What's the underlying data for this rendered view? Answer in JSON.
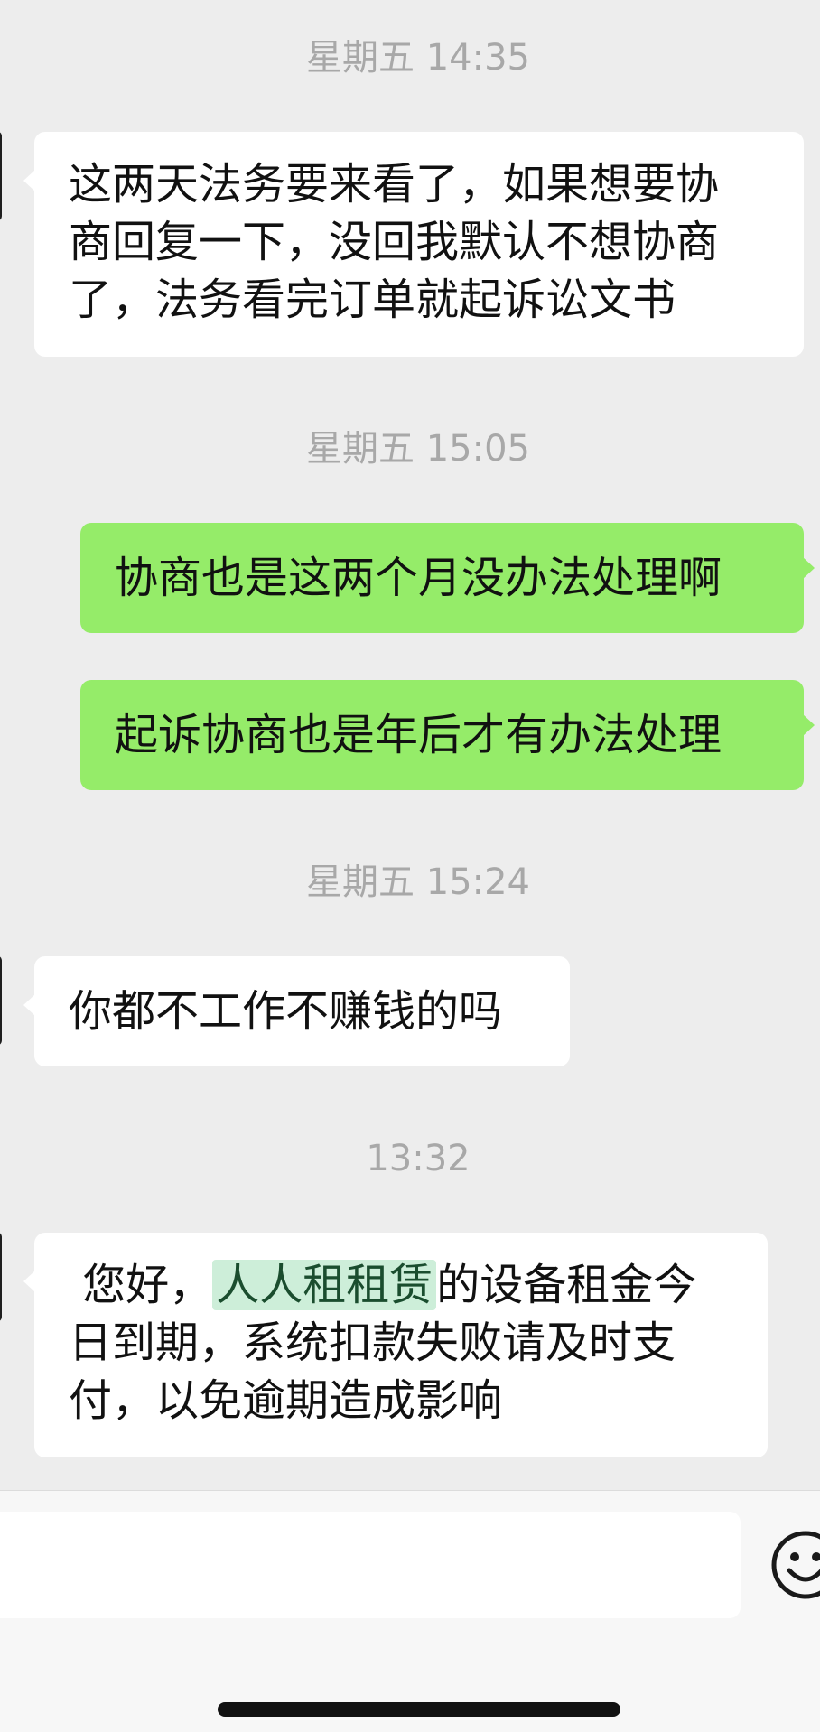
{
  "messages": [
    {
      "type": "time",
      "text": "星期五 14:35"
    },
    {
      "type": "in",
      "lines": [
        "这两天法务要来看了，如果想要协",
        "商回复一下，没回我默认不想协商",
        "了，法务看完订单就起诉讼文书"
      ]
    },
    {
      "type": "time",
      "text": "星期五 15:05"
    },
    {
      "type": "out",
      "lines": [
        "协商也是这两个月没办法处理啊"
      ]
    },
    {
      "type": "out",
      "lines": [
        "起诉协商也是年后才有办法处理"
      ]
    },
    {
      "type": "time",
      "text": "星期五 15:24"
    },
    {
      "type": "in",
      "lines": [
        "你都不工作不赚钱的吗"
      ]
    },
    {
      "type": "time",
      "text": "13:32"
    },
    {
      "type": "in",
      "prefix": "您好，",
      "highlight": "人人租租赁",
      "suffix": "的设备租金今",
      "lines": [
        "日到期，系统扣款失败请及时支",
        "付，以免逾期造成影响"
      ]
    }
  ],
  "input": {
    "value": "",
    "placeholder": ""
  },
  "icons": {
    "emoji": "smiley-face-icon",
    "home": "home-indicator"
  },
  "colors": {
    "incoming": "#ffffff",
    "outgoing": "#95ec69",
    "background": "#ededed",
    "highlight": "#cdeed9"
  }
}
